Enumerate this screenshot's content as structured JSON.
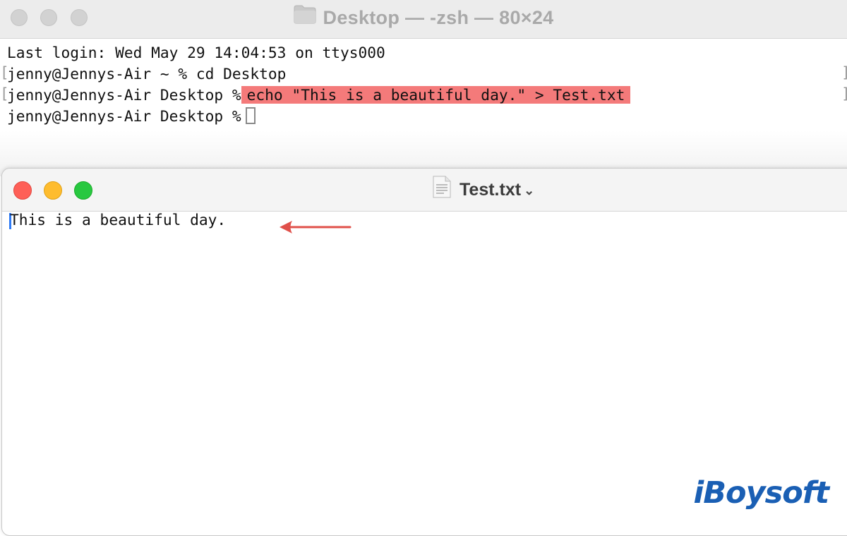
{
  "terminal": {
    "title": "Desktop — -zsh — 80×24",
    "lines": [
      "Last login: Wed May 29 14:04:53 on ttys000",
      "jenny@Jennys-Air ~ % cd Desktop",
      "jenny@Jennys-Air Desktop %",
      "jenny@Jennys-Air Desktop %"
    ],
    "highlighted_command": "echo \"This is a beautiful day.\" > Test.txt",
    "highlight_color": "#f47a7a"
  },
  "textedit": {
    "title": "Test.txt",
    "content": "This is a beautiful day.",
    "annotation_color": "#e0504a"
  },
  "watermark": {
    "text": "iBoysoft"
  }
}
